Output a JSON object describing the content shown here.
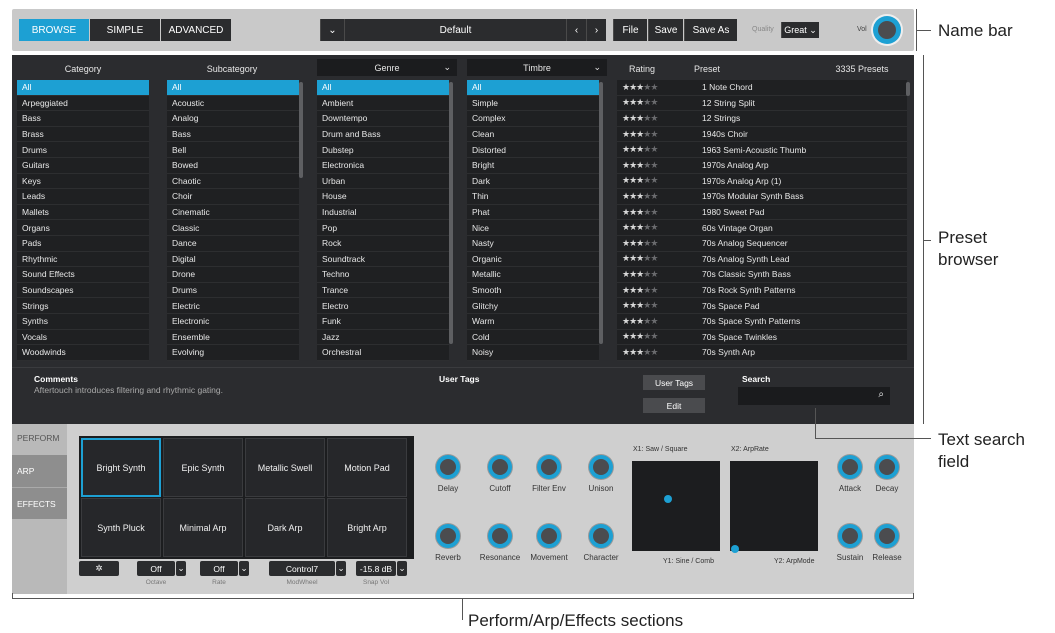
{
  "modes": [
    "BROWSE",
    "SIMPLE",
    "ADVANCED"
  ],
  "preset_name": "Default",
  "file_label": "File",
  "save_label": "Save",
  "saveas_label": "Save As",
  "quality_label": "Quality",
  "quality_value": "Great",
  "vol_label": "Vol",
  "columns": {
    "category": "Category",
    "subcategory": "Subcategory",
    "genre": "Genre",
    "timbre": "Timbre",
    "rating": "Rating",
    "preset": "Preset",
    "count": "3335 Presets"
  },
  "category": [
    "All",
    "Arpeggiated",
    "Bass",
    "Brass",
    "Drums",
    "Guitars",
    "Keys",
    "Leads",
    "Mallets",
    "Organs",
    "Pads",
    "Rhythmic",
    "Sound Effects",
    "Soundscapes",
    "Strings",
    "Synths",
    "Vocals",
    "Woodwinds"
  ],
  "subcategory": [
    "All",
    "Acoustic",
    "Analog",
    "Bass",
    "Bell",
    "Bowed",
    "Chaotic",
    "Choir",
    "Cinematic",
    "Classic",
    "Dance",
    "Digital",
    "Drone",
    "Drums",
    "Electric",
    "Electronic",
    "Ensemble",
    "Evolving"
  ],
  "genre": [
    "All",
    "Ambient",
    "Downtempo",
    "Drum and Bass",
    "Dubstep",
    "Electronica",
    "Urban",
    "House",
    "Industrial",
    "Pop",
    "Rock",
    "Soundtrack",
    "Techno",
    "Trance",
    "Electro",
    "Funk",
    "Jazz",
    "Orchestral"
  ],
  "timbre": [
    "All",
    "Simple",
    "Complex",
    "Clean",
    "Distorted",
    "Bright",
    "Dark",
    "Thin",
    "Phat",
    "Nice",
    "Nasty",
    "Organic",
    "Metallic",
    "Smooth",
    "Glitchy",
    "Warm",
    "Cold",
    "Noisy"
  ],
  "presets": [
    "1 Note Chord",
    "12 String Split",
    "12 Strings",
    "1940s Choir",
    "1963 Semi-Acoustic Thumb",
    "1970s Analog Arp",
    "1970s Analog Arp (1)",
    "1970s Modular Synth Bass",
    "1980 Sweet Pad",
    "60s Vintage Organ",
    "70s Analog Sequencer",
    "70s Analog Synth Lead",
    "70s Classic Synth Bass",
    "70s Rock Synth Patterns",
    "70s Space Pad",
    "70s Space Synth Patterns",
    "70s Space Twinkles",
    "70s Synth Arp"
  ],
  "ratings": [
    3,
    3,
    3,
    3,
    3,
    3,
    3,
    3,
    3,
    3,
    3,
    3,
    3,
    3,
    3,
    3,
    3,
    3
  ],
  "comments_label": "Comments",
  "comments_text": "Aftertouch introduces filtering and rhythmic gating.",
  "usertags_label": "User Tags",
  "usertags_btn": "User Tags",
  "edit_btn": "Edit",
  "search_label": "Search",
  "tabs": [
    "PERFORM",
    "ARP",
    "EFFECTS"
  ],
  "pads": [
    "Bright Synth",
    "Epic Synth",
    "Metallic Swell",
    "Motion Pad",
    "Synth Pluck",
    "Minimal Arp",
    "Dark Arp",
    "Bright Arp"
  ],
  "controls": [
    {
      "value": "Off",
      "label": "Octave"
    },
    {
      "value": "Off",
      "label": "Rate"
    },
    {
      "value": "Control7",
      "label": "ModWheel"
    },
    {
      "value": "-15.8 dB",
      "label": "Snap Vol"
    }
  ],
  "knobs_top": [
    "Delay",
    "Cutoff",
    "Filter Env",
    "Unison"
  ],
  "knobs_bottom": [
    "Reverb",
    "Resonance",
    "Movement",
    "Character"
  ],
  "xy1": {
    "x": "X1: Saw / Square",
    "y": "Y1: Sine / Comb"
  },
  "xy2": {
    "x": "X2: ArpRate",
    "y": "Y2: ArpMode"
  },
  "env": [
    "Attack",
    "Decay",
    "Sustain",
    "Release"
  ],
  "callouts": [
    "Name bar",
    "Preset",
    "browser",
    "Text search",
    "field",
    "Perform/Arp/Effects sections"
  ],
  "accent": "#1da0d3"
}
